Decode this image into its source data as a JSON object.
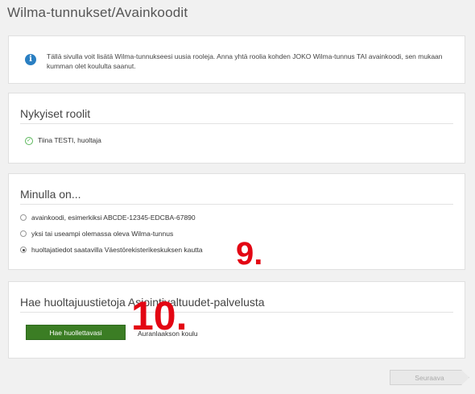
{
  "page": {
    "title": "Wilma-tunnukset/Avainkoodit"
  },
  "info": {
    "text": "Tällä sivulla voit lisätä Wilma-tunnukseesi uusia rooleja. Anna yhtä roolia kohden JOKO Wilma-tunnus TAI avainkoodi, sen mukaan kumman olet koululta saanut."
  },
  "current_roles": {
    "title": "Nykyiset roolit",
    "items": [
      {
        "label": "Tiina TESTI, huoltaja"
      }
    ]
  },
  "choice": {
    "title": "Minulla on...",
    "options": [
      {
        "label": "avainkoodi, esimerkiksi ABCDE-12345-EDCBA-67890",
        "selected": false
      },
      {
        "label": "yksi tai useampi olemassa oleva Wilma-tunnus",
        "selected": false
      },
      {
        "label": "huoltajatiedot saatavilla Väestörekisterikeskuksen kautta",
        "selected": true
      }
    ]
  },
  "fetch": {
    "title": "Hae huoltajuustietoja Asiointivaltuudet-palvelusta",
    "button_label": "Hae huollettavasi",
    "school": "Auranlaakson koulu"
  },
  "footer": {
    "next_label": "Seuraava"
  },
  "annotations": {
    "step9": "9.",
    "step10": "10."
  },
  "colors": {
    "accent_green": "#3b7d24",
    "info_blue": "#2a7fc2",
    "annotation_red": "#e30613"
  }
}
